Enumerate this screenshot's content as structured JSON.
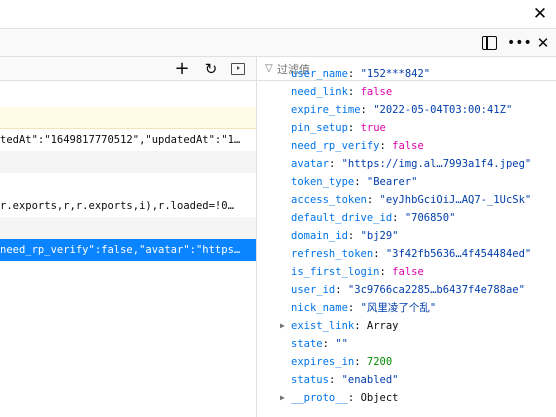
{
  "window": {
    "close_glyph": "✕"
  },
  "devtools_toolbar": {
    "dock_icon": "dock-side-icon",
    "more_glyph": "•••",
    "close_glyph": "✕"
  },
  "left_pane": {
    "toolbar": {
      "add_glyph": "+",
      "refresh_glyph": "↻",
      "sidebar_icon": "toggle-sidebar-icon"
    },
    "rows": [
      {
        "text": "",
        "style": "hl"
      },
      {
        "text": "tedAt\":\"1649817770512\",\"updatedAt\":\"1…",
        "style": "plain"
      },
      {
        "text": "",
        "style": "alt"
      },
      {
        "text": "",
        "style": "plain"
      },
      {
        "text": "r.exports,r,r.exports,i),r.loaded=!0…",
        "style": "plain"
      },
      {
        "text": "",
        "style": "alt"
      },
      {
        "text": "need_rp_verify\":false,\"avatar\":\"https…",
        "style": "sel"
      }
    ]
  },
  "filter": {
    "placeholder": "过滤值",
    "value": "",
    "icon": "filter-icon"
  },
  "properties": [
    {
      "key": "user_name",
      "value": "\"152***842\"",
      "type": "string",
      "expandable": false
    },
    {
      "key": "need_link",
      "value": "false",
      "type": "bool",
      "expandable": false
    },
    {
      "key": "expire_time",
      "value": "\"2022-05-04T03:00:41Z\"",
      "type": "string",
      "expandable": false
    },
    {
      "key": "pin_setup",
      "value": "true",
      "type": "bool",
      "expandable": false
    },
    {
      "key": "need_rp_verify",
      "value": "false",
      "type": "bool",
      "expandable": false
    },
    {
      "key": "avatar",
      "value": "\"https://img.al…7993a1f4.jpeg\"",
      "type": "string",
      "expandable": false
    },
    {
      "key": "token_type",
      "value": "\"Bearer\"",
      "type": "string",
      "expandable": false
    },
    {
      "key": "access_token",
      "value": "\"eyJhbGciOiJ…AQ7-_1UcSk\"",
      "type": "string",
      "expandable": false
    },
    {
      "key": "default_drive_id",
      "value": "\"706850\"",
      "type": "string",
      "expandable": false
    },
    {
      "key": "domain_id",
      "value": "\"bj29\"",
      "type": "string",
      "expandable": false
    },
    {
      "key": "refresh_token",
      "value": "\"3f42fb5636…4f454484ed\"",
      "type": "string",
      "expandable": false
    },
    {
      "key": "is_first_login",
      "value": "false",
      "type": "bool",
      "expandable": false
    },
    {
      "key": "user_id",
      "value": "\"3c9766ca2285…b6437f4e788ae\"",
      "type": "string",
      "expandable": false
    },
    {
      "key": "nick_name",
      "value": "\"风里凌了个乱\"",
      "type": "string",
      "expandable": false
    },
    {
      "key": "exist_link",
      "value": "Array",
      "type": "object",
      "expandable": true
    },
    {
      "key": "state",
      "value": "\"\"",
      "type": "string",
      "expandable": false
    },
    {
      "key": "expires_in",
      "value": "7200",
      "type": "number",
      "expandable": false
    },
    {
      "key": "status",
      "value": "\"enabled\"",
      "type": "string",
      "expandable": false
    },
    {
      "key": "__proto__",
      "value": "Object",
      "type": "object",
      "expandable": true
    }
  ],
  "colors": {
    "selection": "#0a84ff",
    "key": "#0074e8",
    "string": "#003eaa",
    "bool": "#dd00a9",
    "number": "#058b00"
  }
}
